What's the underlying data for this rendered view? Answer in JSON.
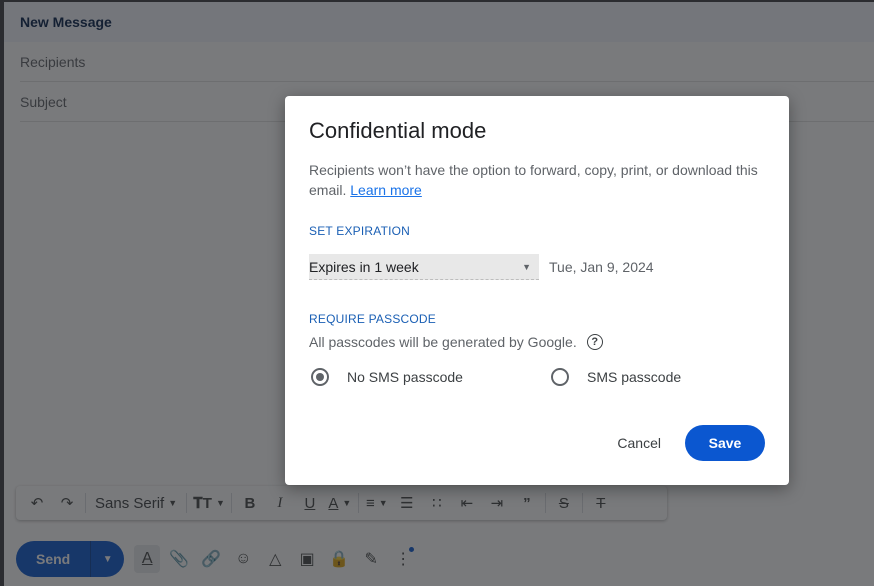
{
  "compose": {
    "title": "New Message",
    "recipients_placeholder": "Recipients",
    "subject_placeholder": "Subject",
    "toolbar": {
      "font": "Sans Serif",
      "icons": [
        "undo-icon",
        "redo-icon",
        "font-select",
        "text-size-icon",
        "bold-icon",
        "italic-icon",
        "underline-icon",
        "text-color-icon",
        "align-icon",
        "numbered-list-icon",
        "bulleted-list-icon",
        "indent-less-icon",
        "indent-more-icon",
        "quote-icon",
        "strikethrough-icon",
        "remove-formatting-icon"
      ]
    },
    "bottom": {
      "send_label": "Send"
    }
  },
  "dialog": {
    "title": "Confidential mode",
    "description": "Recipients won’t have the option to forward, copy, print, or download this email.",
    "learn_more": "Learn more",
    "expiration": {
      "label": "SET EXPIRATION",
      "selected": "Expires in 1 week",
      "date": "Tue, Jan 9, 2024"
    },
    "passcode": {
      "label": "REQUIRE PASSCODE",
      "note": "All passcodes will be generated by Google.",
      "options": [
        {
          "label": "No SMS passcode",
          "checked": true
        },
        {
          "label": "SMS passcode",
          "checked": false
        }
      ]
    },
    "cancel_label": "Cancel",
    "save_label": "Save",
    "accent_color": "#0b57d0"
  }
}
